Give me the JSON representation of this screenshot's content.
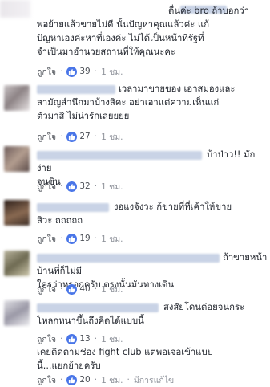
{
  "comments": [
    {
      "text": "ตื่นค่ะ bro ถ้าบอกว่า\nพอย้ายแล้วขายไม่ดี นั้นปัญหาคุณแล้วค่ะ แก้\nปัญหาเองค่ะหาที่เองค่ะ ไม่ได้เป็นหน้าที่รัฐที่\nจำเป็นมาอำนวยสถานที่ให้คุณนะคะ",
      "like_label": "ถูกใจ",
      "reaction_count": "39",
      "time": "1 ชม."
    },
    {
      "text": "เวลามาขายของ เอาสมองและ\nสามัญสำนึกมาบ้างสิคะ อย่าเอาแต่ความเห็นแก่\nตัวมาสิ ไม่น่ารักเลยยยย",
      "like_label": "ถูกใจ",
      "reaction_count": "27",
      "time": "1 ชม."
    },
    {
      "text": "บ้าป่าว!! มักง่าย\nจนชิน",
      "like_label": "ถูกใจ",
      "reaction_count": "32",
      "time": "1 ชม."
    },
    {
      "text": "งอแงจังวะ ก้ขายที่ที่เค้าให้ขาย\nสิวะ ถถถถถ",
      "like_label": "ถูกใจ",
      "reaction_count": "19",
      "time": "1 ชม."
    },
    {
      "text": "ถ้าขายหน้าบ้านพี่ก็ไม่มี\nใครว่าหรอกครับ ตรงนั้นมันทางเดิน",
      "like_label": "ถูกใจ",
      "reaction_count": "40",
      "time": "1 ชม."
    },
    {
      "text": "สงสัยโดนต่อยจนกระ\nโหลกหนาขึ้นถึงคิดได้แบบนี้",
      "like_label": "ถูกใจ",
      "reaction_count": "13",
      "time": "1 ชม."
    },
    {
      "text": "เคยติดตามช่อง fight club แต่พอเจอเข้าแบบ\nนี้...แยกย้ายครับ",
      "like_label": "ถูกใจ",
      "reaction_count": "20",
      "time": "1 ชม.",
      "edited_label": "มีการแก้ไข"
    }
  ],
  "colors": {
    "like_blue": "#4a76e8",
    "meta_gray": "#90949c",
    "text": "#1d2129",
    "blurred_name": "#c9d3e6"
  },
  "icons": {
    "reaction": "thumbs-up-icon"
  }
}
